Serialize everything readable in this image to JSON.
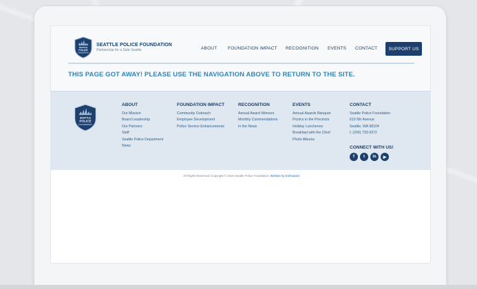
{
  "brand": {
    "name": "SEATTLE POLICE FOUNDATION",
    "tagline": "Partnership for a Safe Seattle",
    "badge_lines": [
      "SEATTLE",
      "POLICE",
      "FOUNDATION"
    ]
  },
  "nav": {
    "items": [
      "ABOUT",
      "FOUNDATION IMPACT",
      "RECOGNITION",
      "EVENTS",
      "CONTACT"
    ],
    "cta": "SUPPORT US"
  },
  "notice": "THIS PAGE GOT AWAY! PLEASE USE THE NAVIGATION ABOVE TO RETURN TO THE SITE.",
  "footer": {
    "columns": [
      {
        "heading": "ABOUT",
        "links": [
          "Our Mission",
          "Board Leadership",
          "Our Partners",
          "Staff",
          "Seattle Police Department",
          "News"
        ]
      },
      {
        "heading": "FOUNDATION IMPACT",
        "links": [
          "Community Outreach",
          "Employee Development",
          "Police Service Enhancements"
        ]
      },
      {
        "heading": "RECOGNITION",
        "links": [
          "Annual Award Winners",
          "Monthly Commendations",
          "In the News"
        ]
      },
      {
        "heading": "EVENTS",
        "links": [
          "Annual Awards Banquet",
          "Picnics in the Precincts",
          "Holiday Luncheons",
          "Breakfast with the Chief",
          "Photo Albums"
        ]
      },
      {
        "heading": "CONTACT",
        "links": [
          "Seattle Police Foundation",
          "610 5th Avenue",
          "Seattle, WA 98104",
          "t: (206) 733-9372"
        ]
      }
    ],
    "connect_heading": "CONNECT WITH US!",
    "social": [
      {
        "icon": "facebook-icon",
        "glyph": "f"
      },
      {
        "icon": "twitter-icon",
        "glyph": "t"
      },
      {
        "icon": "linkedin-icon",
        "glyph": "in"
      },
      {
        "icon": "youtube-icon",
        "glyph": "▶"
      }
    ]
  },
  "copyright": "All Rights Reserved. Copyright © 2016 Seattle Police Foundation.",
  "credit": "Website by Enthusiast",
  "colors": {
    "navy": "#1c3f6e",
    "accent": "#2f86b8",
    "footer_bg": "#dfe8f1"
  }
}
